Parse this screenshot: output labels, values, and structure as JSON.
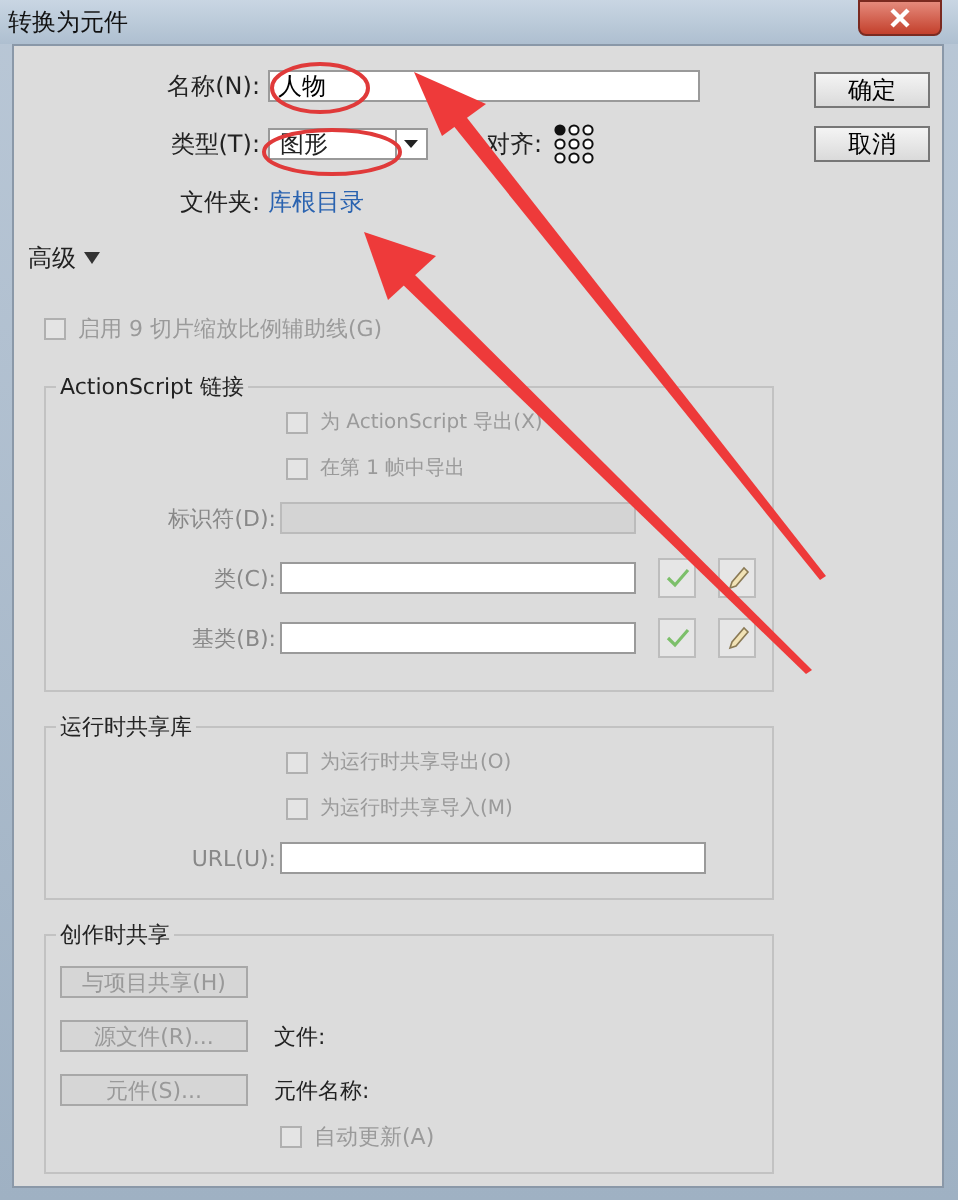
{
  "window": {
    "title": "转换为元件"
  },
  "name_field": {
    "label": "名称(N):",
    "value": "人物"
  },
  "type_field": {
    "label": "类型(T):",
    "value": "图形"
  },
  "align_label": "对齐:",
  "folder": {
    "label": "文件夹:",
    "link": "库根目录"
  },
  "buttons": [
    "确定",
    "取消"
  ],
  "advanced": {
    "label": "高级",
    "expanded": true
  },
  "slice_guides": {
    "label": "启用 9 切片缩放比例辅助线(G)",
    "checked": false,
    "disabled": true
  },
  "actionscript": {
    "title": "ActionScript 链接",
    "checkboxes": [
      {
        "label": "为 ActionScript 导出(X)",
        "checked": false,
        "disabled": true
      },
      {
        "label": "在第 1 帧中导出",
        "checked": false,
        "disabled": true
      }
    ],
    "fields": [
      {
        "label": "标识符(D):",
        "disabled": true,
        "kind": "plain"
      },
      {
        "label": "类(C):",
        "disabled": false,
        "kind": "tools"
      },
      {
        "label": "基类(B):",
        "disabled": false,
        "kind": "tools"
      }
    ]
  },
  "runtime": {
    "title": "运行时共享库",
    "checkboxes": [
      {
        "label": "为运行时共享导出(O)",
        "checked": false,
        "disabled": true
      },
      {
        "label": "为运行时共享导入(M)",
        "checked": false,
        "disabled": true
      }
    ],
    "url_label": "URL(U):"
  },
  "authortime": {
    "title": "创作时共享",
    "rows": [
      {
        "button": "与项目共享(H)"
      },
      {
        "button": "源文件(R)...",
        "label": "文件:"
      },
      {
        "button": "元件(S)...",
        "label": "元件名称:"
      }
    ],
    "auto_update": {
      "label": "自动更新(A)",
      "checked": false,
      "disabled": true
    }
  }
}
